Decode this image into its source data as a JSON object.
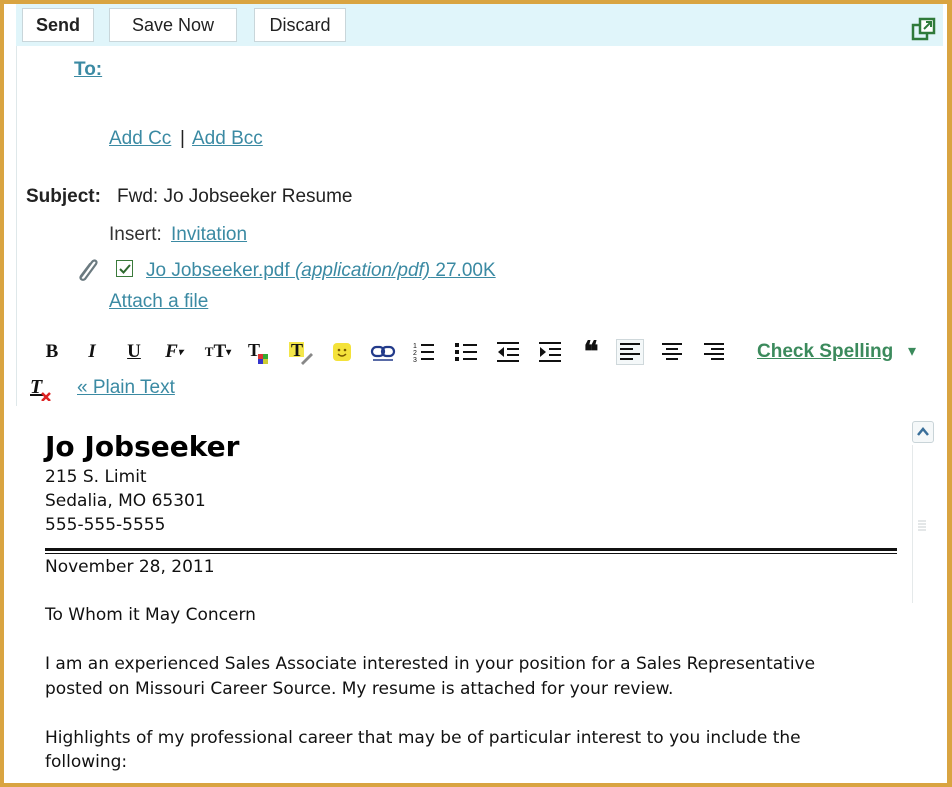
{
  "toolbar": {
    "send_label": "Send",
    "save_label": "Save Now",
    "discard_label": "Discard"
  },
  "header": {
    "to_label": "To:",
    "add_cc": "Add Cc",
    "separator": "|",
    "add_bcc": "Add Bcc",
    "subject_label": "Subject:",
    "subject_value": "Fwd: Jo Jobseeker Resume",
    "insert_label": "Insert:",
    "insert_invitation": "Invitation",
    "attachment": {
      "name": "Jo Jobseeker.pdf",
      "type": "(application/pdf)",
      "size": "27.00K",
      "checked": true
    },
    "attach_file": "Attach a file"
  },
  "format_toolbar": {
    "buttons": [
      "bold",
      "italic",
      "underline",
      "font",
      "font-size",
      "text-color",
      "highlight",
      "emoticon",
      "link",
      "numbered-list",
      "bullet-list",
      "outdent",
      "indent",
      "quote",
      "align-left",
      "align-center",
      "align-right"
    ],
    "check_spelling": "Check Spelling",
    "plain_text": "« Plain Text"
  },
  "letter": {
    "name": "Jo Jobseeker",
    "address1": "215 S. Limit",
    "address2": "Sedalia, MO 65301",
    "phone": "555-555-5555",
    "date": "November 28, 2011",
    "salutation": "To Whom it May Concern",
    "para1_line1": "I am an experienced Sales Associate interested in your position for a Sales Representative",
    "para1_line2": "posted on Missouri Career Source. My resume is attached for your review.",
    "para2_line1": "Highlights of my professional career that may be of particular interest to you include the",
    "para2_line2": "following:"
  },
  "colors": {
    "link": "#3b8aa3",
    "topbar": "#e0f5fa",
    "frame": "#d9a441",
    "spell": "#3b8a5c"
  }
}
